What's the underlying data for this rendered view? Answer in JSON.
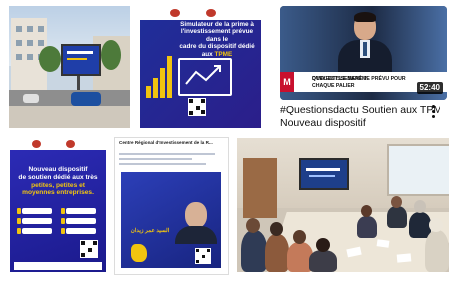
{
  "grid": {
    "tiles": [
      {
        "kind": "image",
        "subject": "street-billboard-photo"
      },
      {
        "kind": "image",
        "subject": "simulator-poster",
        "text": {
          "title_line1": "Simulateur de la prime à",
          "title_line2": "l'investissement prévue dans le",
          "title_line3": "cadre du dispositif dédié aux",
          "title_highlight": "TPME"
        }
      },
      {
        "kind": "video",
        "thumbnail": {
          "channel_mark": "M",
          "lower_third_line1": "QUEL EST LE BARÈME PRÉVU POUR CHAQUE PALIER",
          "lower_third_line2": "D'INVESTISSEMENT ?"
        },
        "duration": "52:40",
        "title_line1": "#Questionsdactu Soutien aux TPME",
        "title_line2": "Nouveau dispositif",
        "menu_icon": "more-vert-icon"
      },
      {
        "kind": "image",
        "subject": "new-dispositif-poster",
        "text": {
          "title_line1": "Nouveau dispositif",
          "title_line2": "de soutien dédié aux très",
          "title_highlight": "petites, petites et",
          "title_highlight2": "moyennes entreprises."
        }
      },
      {
        "kind": "image",
        "subject": "crt-document-poster",
        "text": {
          "doc_title": "Centre Régional d'Investissement de la R...",
          "poster_name": "السيد عمر زيدان"
        }
      },
      {
        "kind": "image",
        "subject": "meeting-room-photo"
      }
    ]
  },
  "colors": {
    "poster_blue": "#1f2f9a",
    "accent_yellow": "#f1c40f",
    "brand_red": "#c8102e",
    "duration_bg": "#000000"
  }
}
